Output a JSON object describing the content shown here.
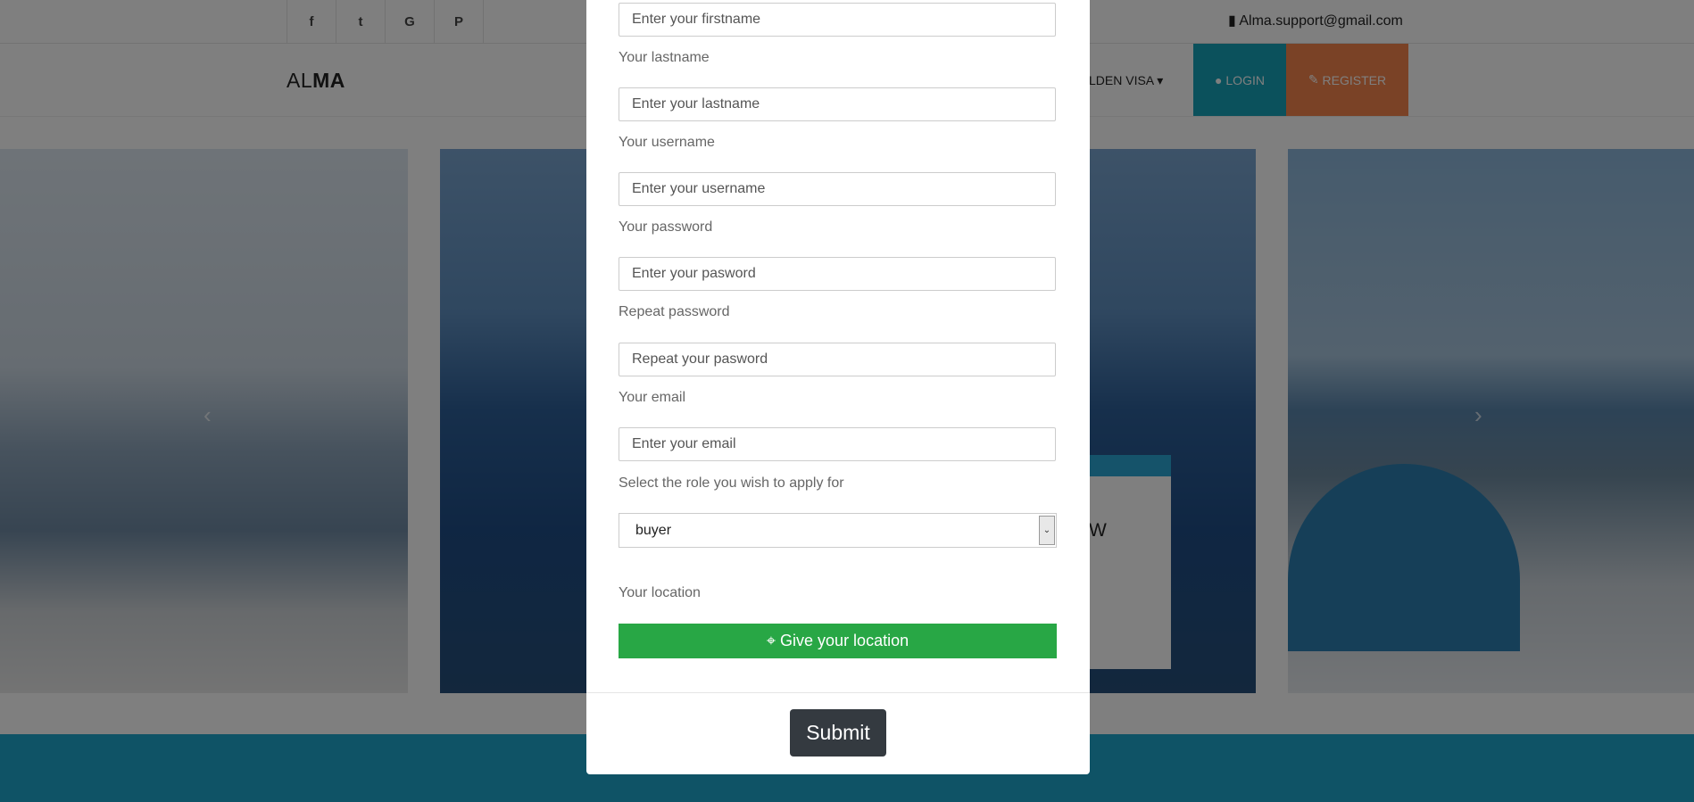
{
  "topbar": {
    "social": [
      "f",
      "t",
      "G",
      "P"
    ],
    "support_icon": "comment-icon",
    "support_email": "Alma.support@gmail.com"
  },
  "navbar": {
    "brand_light": "AL",
    "brand_bold": "MA",
    "nav_item": "LDEN VISA",
    "login": "LOGIN",
    "register": "REGISTER"
  },
  "background": {
    "card_text": "W",
    "prev_arrow": "‹",
    "next_arrow": "›"
  },
  "form": {
    "firstname_placeholder": "Enter your firstname",
    "lastname_label": "Your lastname",
    "lastname_placeholder": "Enter your lastname",
    "username_label": "Your username",
    "username_placeholder": "Enter your username",
    "password_label": "Your password",
    "password_placeholder": "Enter your pasword",
    "repeat_label": "Repeat password",
    "repeat_placeholder": "Repeat your pasword",
    "email_label": "Your email",
    "email_placeholder": "Enter your email",
    "role_label": "Select the role you wish to apply for",
    "role_value": "buyer",
    "location_label": "Your location",
    "location_button": "Give your location",
    "submit": "Submit"
  },
  "colors": {
    "login": "#17a2b8",
    "register": "#f5854c",
    "location": "#28a745",
    "submit": "#343a40",
    "footer": "#1fa7cc"
  }
}
